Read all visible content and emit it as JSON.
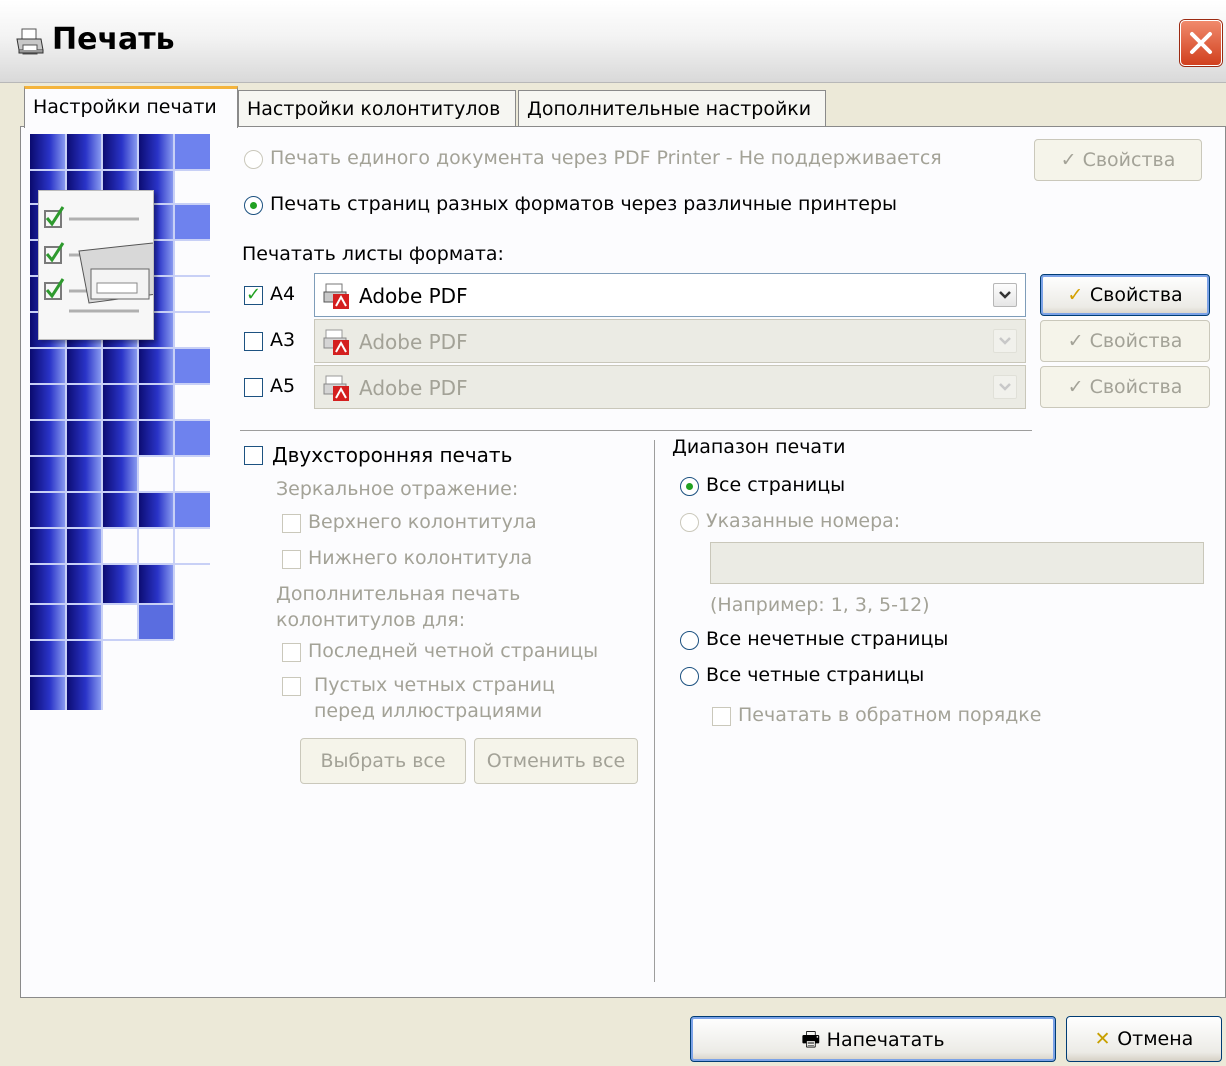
{
  "window": {
    "title": "Печать",
    "accent": "#f4b43c",
    "close_color": "#d1401e"
  },
  "tabs": [
    {
      "label": "Настройки печати",
      "active": true
    },
    {
      "label": "Настройки колонтитулов",
      "active": false
    },
    {
      "label": "Дополнительные настройки",
      "active": false
    }
  ],
  "print_mode": {
    "single_pdf_label": "Печать единого документа через PDF Printer - Не поддерживается",
    "multi_label": "Печать страниц разных форматов через различные принтеры",
    "properties_label": "Свойства"
  },
  "formats": {
    "heading": "Печатать листы формата:",
    "rows": [
      {
        "format": "A4",
        "printer": "Adobe PDF",
        "checked": true,
        "button": "Свойства"
      },
      {
        "format": "A3",
        "printer": "Adobe PDF",
        "checked": false,
        "button": "Свойства"
      },
      {
        "format": "A5",
        "printer": "Adobe PDF",
        "checked": false,
        "button": "Свойства"
      }
    ]
  },
  "duplex": {
    "label": "Двухсторонняя печать",
    "mirror_label": "Зеркальное отражение:",
    "header_label": "Верхнего колонтитула",
    "footer_label": "Нижнего колонтитула",
    "extra_label_1": "Дополнительная печать",
    "extra_label_2": "колонтитулов для:",
    "last_even_label": "Последней четной страницы",
    "empty_even_label_1": "Пустых четных страниц",
    "empty_even_label_2": "перед иллюстрациями",
    "select_all": "Выбрать все",
    "deselect_all": "Отменить все"
  },
  "range": {
    "heading": "Диапазон печати",
    "all_pages": "Все страницы",
    "specified": "Указанные номера:",
    "example": "(Например: 1, 3, 5-12)",
    "odd": "Все нечетные страницы",
    "even": "Все четные страницы",
    "reverse": "Печатать в обратном порядке"
  },
  "footer": {
    "print": "Напечатать",
    "cancel": "Отмена"
  }
}
